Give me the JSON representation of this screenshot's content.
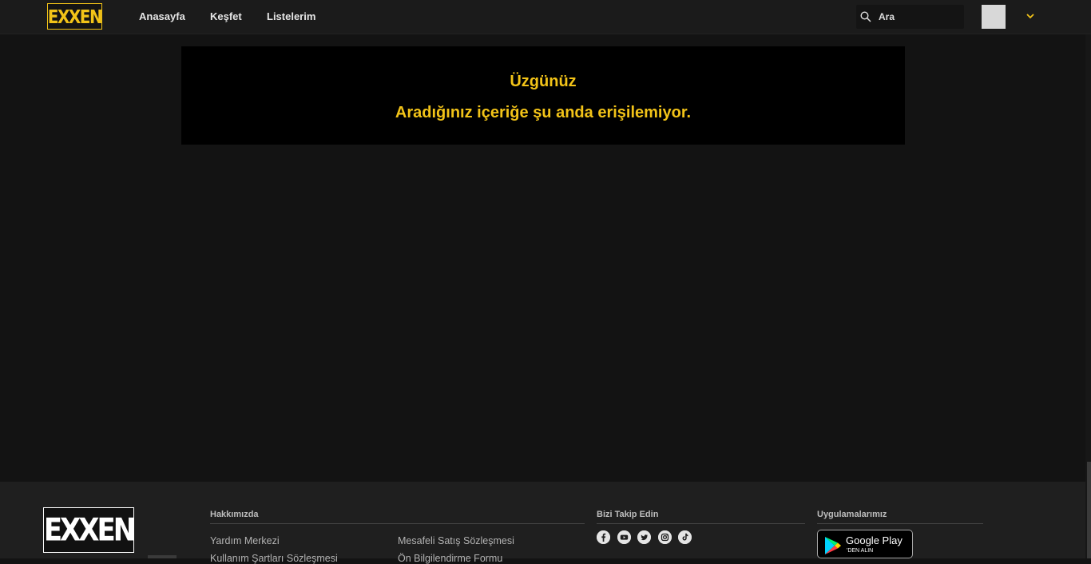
{
  "header": {
    "logo": "EXXEN",
    "nav": [
      "Anasayfa",
      "Keşfet",
      "Listelerim"
    ],
    "search_placeholder": "Ara"
  },
  "main": {
    "title": "Üzgünüz",
    "message": "Aradığınız içeriğe şu anda erişilemiyor."
  },
  "footer": {
    "logo": "EXXEN",
    "about_heading": "Hakkımızda",
    "links_col1": [
      "Yardım Merkezi",
      "Kullanım Şartları Sözleşmesi"
    ],
    "links_col2": [
      "Mesafeli Satış Sözleşmesi",
      "Ön Bilgilendirme Formu"
    ],
    "follow_heading": "Bizi Takip Edin",
    "social_icons": [
      "facebook-icon",
      "youtube-icon",
      "twitter-icon",
      "instagram-icon",
      "tiktok-icon"
    ],
    "apps_heading": "Uygulamalarımız",
    "google_play": {
      "line1": "Google Play",
      "line2": "'DEN ALIN"
    }
  },
  "colors": {
    "accent": "#f2c318",
    "background": "#131313",
    "header": "#1b1b1b",
    "footer": "#1f1f1f"
  }
}
